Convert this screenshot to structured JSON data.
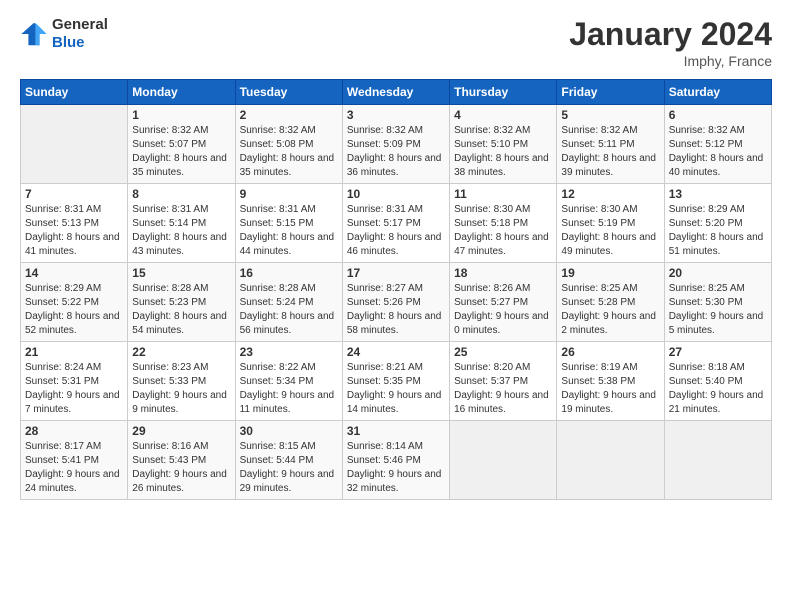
{
  "header": {
    "logo_line1": "General",
    "logo_line2": "Blue",
    "month_title": "January 2024",
    "location": "Imphy, France"
  },
  "days_of_week": [
    "Sunday",
    "Monday",
    "Tuesday",
    "Wednesday",
    "Thursday",
    "Friday",
    "Saturday"
  ],
  "weeks": [
    [
      {
        "num": "",
        "sunrise": "",
        "sunset": "",
        "daylight": ""
      },
      {
        "num": "1",
        "sunrise": "Sunrise: 8:32 AM",
        "sunset": "Sunset: 5:07 PM",
        "daylight": "Daylight: 8 hours and 35 minutes."
      },
      {
        "num": "2",
        "sunrise": "Sunrise: 8:32 AM",
        "sunset": "Sunset: 5:08 PM",
        "daylight": "Daylight: 8 hours and 35 minutes."
      },
      {
        "num": "3",
        "sunrise": "Sunrise: 8:32 AM",
        "sunset": "Sunset: 5:09 PM",
        "daylight": "Daylight: 8 hours and 36 minutes."
      },
      {
        "num": "4",
        "sunrise": "Sunrise: 8:32 AM",
        "sunset": "Sunset: 5:10 PM",
        "daylight": "Daylight: 8 hours and 38 minutes."
      },
      {
        "num": "5",
        "sunrise": "Sunrise: 8:32 AM",
        "sunset": "Sunset: 5:11 PM",
        "daylight": "Daylight: 8 hours and 39 minutes."
      },
      {
        "num": "6",
        "sunrise": "Sunrise: 8:32 AM",
        "sunset": "Sunset: 5:12 PM",
        "daylight": "Daylight: 8 hours and 40 minutes."
      }
    ],
    [
      {
        "num": "7",
        "sunrise": "Sunrise: 8:31 AM",
        "sunset": "Sunset: 5:13 PM",
        "daylight": "Daylight: 8 hours and 41 minutes."
      },
      {
        "num": "8",
        "sunrise": "Sunrise: 8:31 AM",
        "sunset": "Sunset: 5:14 PM",
        "daylight": "Daylight: 8 hours and 43 minutes."
      },
      {
        "num": "9",
        "sunrise": "Sunrise: 8:31 AM",
        "sunset": "Sunset: 5:15 PM",
        "daylight": "Daylight: 8 hours and 44 minutes."
      },
      {
        "num": "10",
        "sunrise": "Sunrise: 8:31 AM",
        "sunset": "Sunset: 5:17 PM",
        "daylight": "Daylight: 8 hours and 46 minutes."
      },
      {
        "num": "11",
        "sunrise": "Sunrise: 8:30 AM",
        "sunset": "Sunset: 5:18 PM",
        "daylight": "Daylight: 8 hours and 47 minutes."
      },
      {
        "num": "12",
        "sunrise": "Sunrise: 8:30 AM",
        "sunset": "Sunset: 5:19 PM",
        "daylight": "Daylight: 8 hours and 49 minutes."
      },
      {
        "num": "13",
        "sunrise": "Sunrise: 8:29 AM",
        "sunset": "Sunset: 5:20 PM",
        "daylight": "Daylight: 8 hours and 51 minutes."
      }
    ],
    [
      {
        "num": "14",
        "sunrise": "Sunrise: 8:29 AM",
        "sunset": "Sunset: 5:22 PM",
        "daylight": "Daylight: 8 hours and 52 minutes."
      },
      {
        "num": "15",
        "sunrise": "Sunrise: 8:28 AM",
        "sunset": "Sunset: 5:23 PM",
        "daylight": "Daylight: 8 hours and 54 minutes."
      },
      {
        "num": "16",
        "sunrise": "Sunrise: 8:28 AM",
        "sunset": "Sunset: 5:24 PM",
        "daylight": "Daylight: 8 hours and 56 minutes."
      },
      {
        "num": "17",
        "sunrise": "Sunrise: 8:27 AM",
        "sunset": "Sunset: 5:26 PM",
        "daylight": "Daylight: 8 hours and 58 minutes."
      },
      {
        "num": "18",
        "sunrise": "Sunrise: 8:26 AM",
        "sunset": "Sunset: 5:27 PM",
        "daylight": "Daylight: 9 hours and 0 minutes."
      },
      {
        "num": "19",
        "sunrise": "Sunrise: 8:25 AM",
        "sunset": "Sunset: 5:28 PM",
        "daylight": "Daylight: 9 hours and 2 minutes."
      },
      {
        "num": "20",
        "sunrise": "Sunrise: 8:25 AM",
        "sunset": "Sunset: 5:30 PM",
        "daylight": "Daylight: 9 hours and 5 minutes."
      }
    ],
    [
      {
        "num": "21",
        "sunrise": "Sunrise: 8:24 AM",
        "sunset": "Sunset: 5:31 PM",
        "daylight": "Daylight: 9 hours and 7 minutes."
      },
      {
        "num": "22",
        "sunrise": "Sunrise: 8:23 AM",
        "sunset": "Sunset: 5:33 PM",
        "daylight": "Daylight: 9 hours and 9 minutes."
      },
      {
        "num": "23",
        "sunrise": "Sunrise: 8:22 AM",
        "sunset": "Sunset: 5:34 PM",
        "daylight": "Daylight: 9 hours and 11 minutes."
      },
      {
        "num": "24",
        "sunrise": "Sunrise: 8:21 AM",
        "sunset": "Sunset: 5:35 PM",
        "daylight": "Daylight: 9 hours and 14 minutes."
      },
      {
        "num": "25",
        "sunrise": "Sunrise: 8:20 AM",
        "sunset": "Sunset: 5:37 PM",
        "daylight": "Daylight: 9 hours and 16 minutes."
      },
      {
        "num": "26",
        "sunrise": "Sunrise: 8:19 AM",
        "sunset": "Sunset: 5:38 PM",
        "daylight": "Daylight: 9 hours and 19 minutes."
      },
      {
        "num": "27",
        "sunrise": "Sunrise: 8:18 AM",
        "sunset": "Sunset: 5:40 PM",
        "daylight": "Daylight: 9 hours and 21 minutes."
      }
    ],
    [
      {
        "num": "28",
        "sunrise": "Sunrise: 8:17 AM",
        "sunset": "Sunset: 5:41 PM",
        "daylight": "Daylight: 9 hours and 24 minutes."
      },
      {
        "num": "29",
        "sunrise": "Sunrise: 8:16 AM",
        "sunset": "Sunset: 5:43 PM",
        "daylight": "Daylight: 9 hours and 26 minutes."
      },
      {
        "num": "30",
        "sunrise": "Sunrise: 8:15 AM",
        "sunset": "Sunset: 5:44 PM",
        "daylight": "Daylight: 9 hours and 29 minutes."
      },
      {
        "num": "31",
        "sunrise": "Sunrise: 8:14 AM",
        "sunset": "Sunset: 5:46 PM",
        "daylight": "Daylight: 9 hours and 32 minutes."
      },
      {
        "num": "",
        "sunrise": "",
        "sunset": "",
        "daylight": ""
      },
      {
        "num": "",
        "sunrise": "",
        "sunset": "",
        "daylight": ""
      },
      {
        "num": "",
        "sunrise": "",
        "sunset": "",
        "daylight": ""
      }
    ]
  ]
}
